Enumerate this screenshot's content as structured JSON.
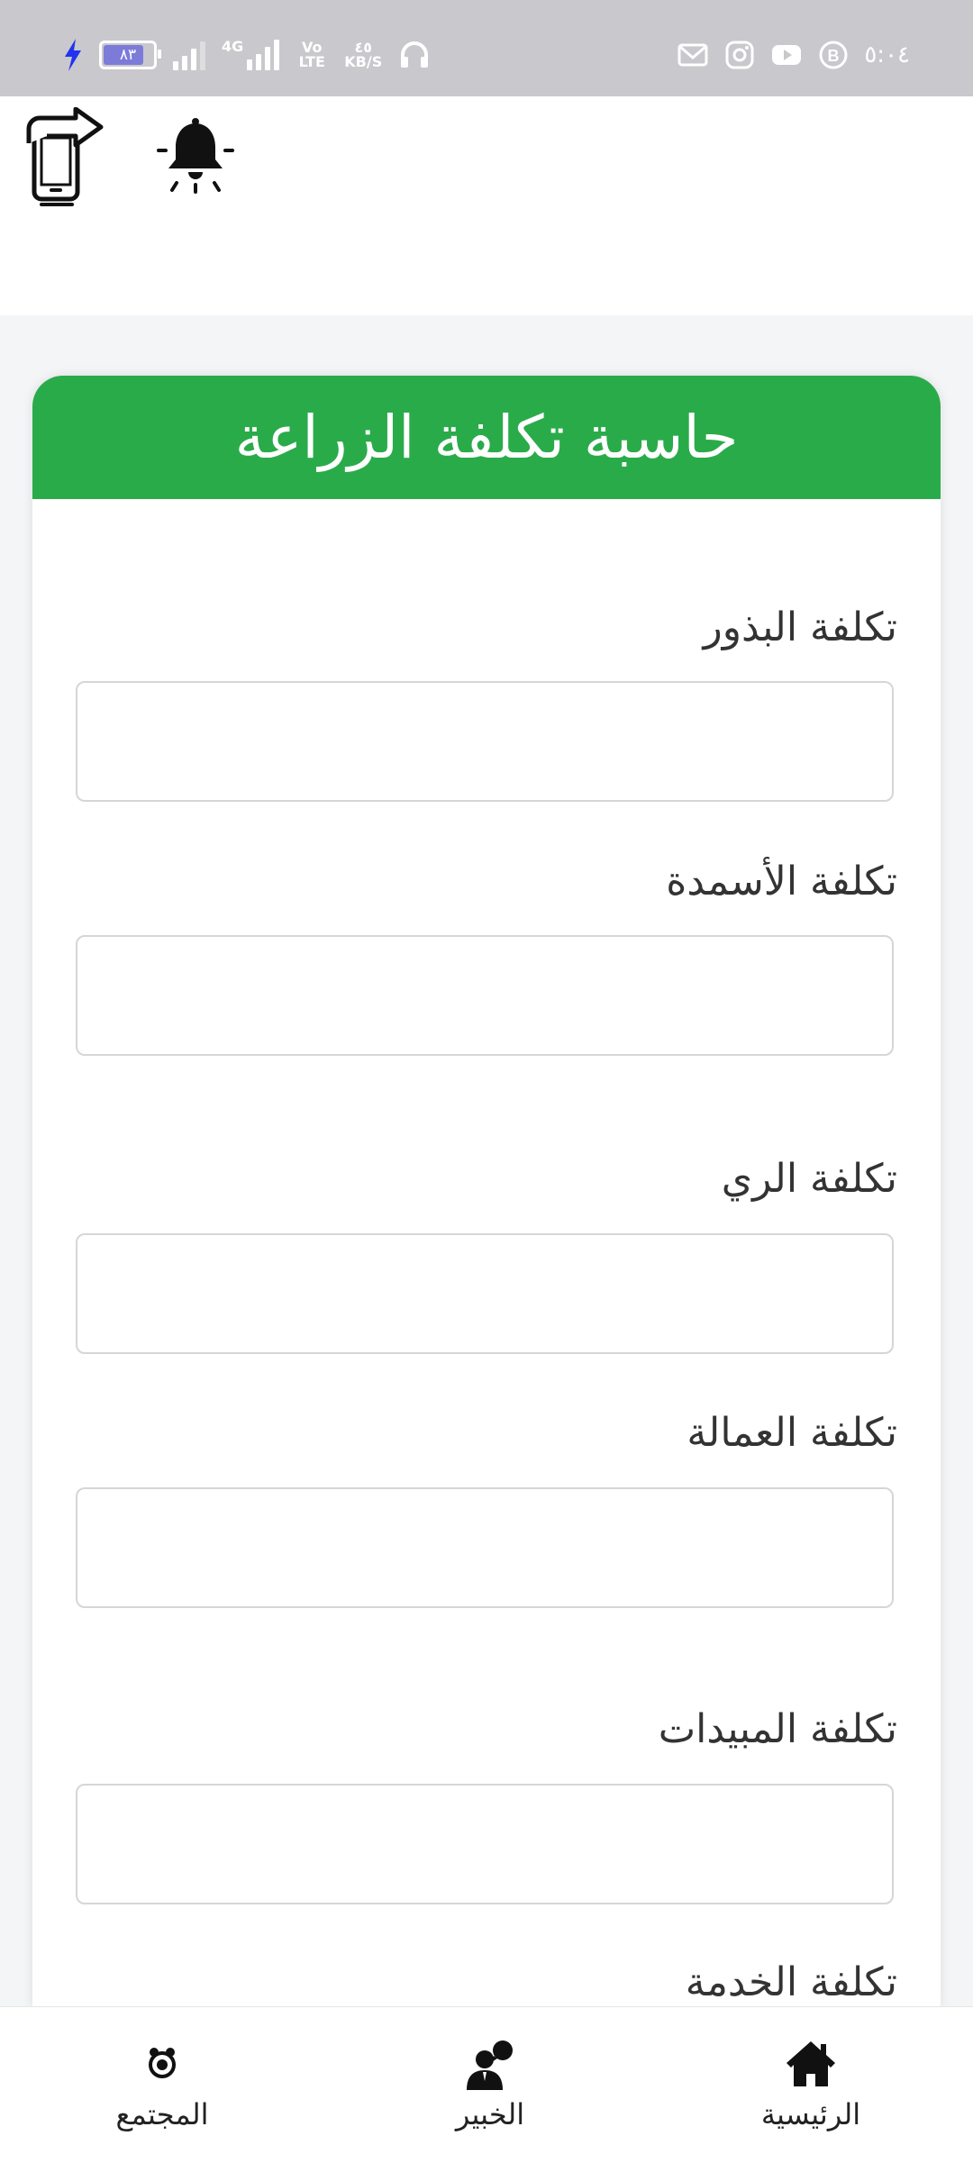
{
  "status_bar": {
    "battery_level": "٨٣",
    "network_type": "4G",
    "volte": "Vo LTE",
    "data_speed_value": "٤٥",
    "data_speed_unit": "KB/S",
    "time": "٥:٠٤",
    "icons": [
      "charging-bolt-icon",
      "battery-icon",
      "signal-icon",
      "signal-4g-icon",
      "volte-icon",
      "headphones-icon",
      "gmail-icon",
      "instagram-icon",
      "youtube-icon",
      "b-app-icon"
    ]
  },
  "app_bar": {
    "icons": [
      "phone-swap-icon",
      "bell-icon"
    ]
  },
  "calculator": {
    "title": "حاسبة تكلفة الزراعة",
    "accent_color": "#2aab4a",
    "fields": [
      {
        "label": "تكلفة البذور",
        "value": ""
      },
      {
        "label": "تكلفة الأسمدة",
        "value": ""
      },
      {
        "label": "تكلفة الري",
        "value": ""
      },
      {
        "label": "تكلفة العمالة",
        "value": ""
      },
      {
        "label": "تكلفة المبيدات",
        "value": ""
      },
      {
        "label": "تكلفة الخدمة",
        "value": ""
      }
    ]
  },
  "bottom_nav": {
    "items": [
      {
        "label": "الرئيسية",
        "icon": "home-icon"
      },
      {
        "label": "الخبير",
        "icon": "expert-icon"
      },
      {
        "label": "المجتمع",
        "icon": "community-icon"
      }
    ]
  }
}
